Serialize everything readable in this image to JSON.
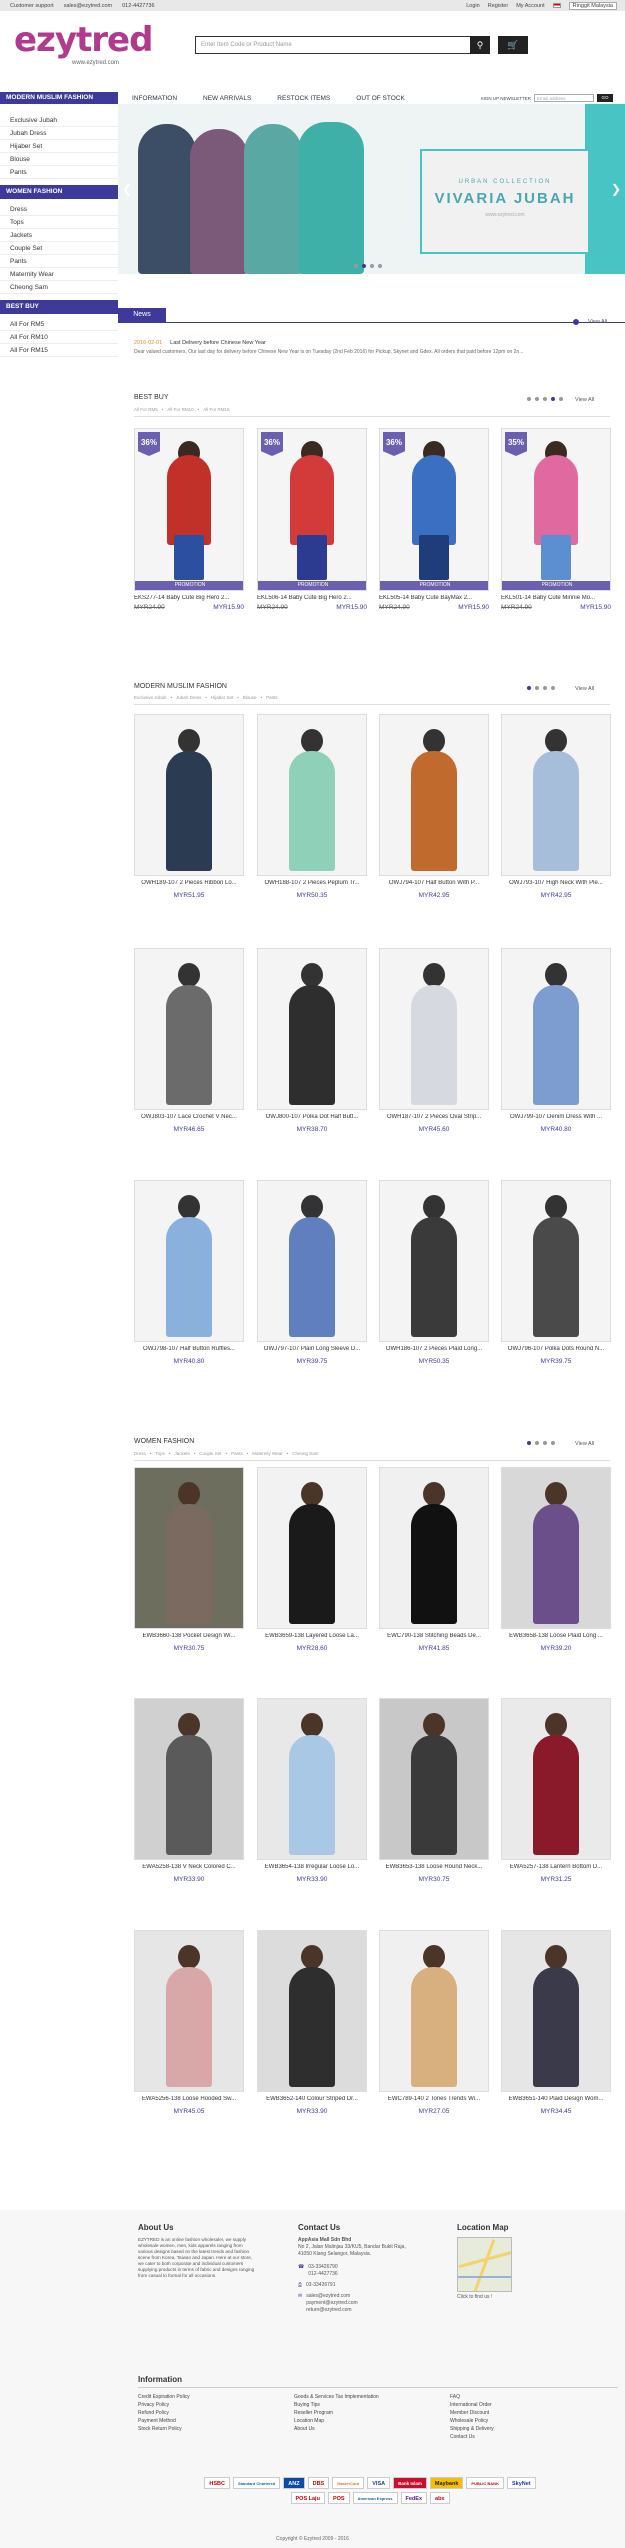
{
  "topbar": {
    "customer_support": "Customer support",
    "email": "sales@ezytred.com",
    "phone": "012-4427736",
    "login": "Login",
    "register": "Register",
    "my_account": "My Account",
    "currency": "Ringgit Malaysia"
  },
  "logo": {
    "text_a": "ezy",
    "text_b": "tred",
    "url": "www.ezytred.com"
  },
  "search": {
    "placeholder": "Enter Item Code or Product Name",
    "icon": "search-icon",
    "cart_icon": "cart-icon"
  },
  "nav": {
    "category_header": "MODERN MUSLIM FASHION",
    "menu": [
      "INFORMATION",
      "NEW ARRIVALS",
      "RESTOCK ITEMS",
      "OUT OF STOCK"
    ],
    "newsletter_label": "SIGN UP NEWSLETTER",
    "newsletter_placeholder": "Email address",
    "newsletter_button": "GO"
  },
  "sidebar": {
    "muslim": [
      "Exclusive Jubah",
      "Jubah Dress",
      "Hijaber Set",
      "Blouse",
      "Pants"
    ],
    "women_header": "WOMEN FASHION",
    "women": [
      "Dress",
      "Tops",
      "Jackets",
      "Couple Set",
      "Pants",
      "Maternity Wear",
      "Cheong Sam"
    ],
    "bestbuy_header": "BEST BUY",
    "bestbuy": [
      "All For RM5",
      "All For RM10",
      "All For RM15"
    ]
  },
  "hero": {
    "line1": "URBAN COLLECTION",
    "line2": "VIVARIA JUBAH",
    "line3": "www.ezytred.com",
    "accent": "#48c4c4"
  },
  "news": {
    "tab": "News",
    "view_all": "View All",
    "date": "2016-02-01",
    "headline": "Last Delivery before Chinese New Year",
    "desc": "Dear valued customers,   Our last day for delivery before Chinese New Year is on Tuesday (2nd Feb 2016) for Pickup, Skynet and Gdex. All orders that paid before 12pm on 2n..."
  },
  "best_buy": {
    "title": "BEST BUY",
    "tabs": [
      "All For RM5",
      "All For RM10",
      "All For RM15"
    ],
    "view_all": "View All",
    "items": [
      {
        "name": "EKS277-14 Baby Cute Big Hero 2...",
        "old": "MYR24.90",
        "new": "MYR15.90",
        "discount": "36%",
        "promo": "PROMOTION"
      },
      {
        "name": "EKL506-14 Baby Cute Big Hero 2...",
        "old": "MYR24.90",
        "new": "MYR15.90",
        "discount": "36%",
        "promo": "PROMOTION"
      },
      {
        "name": "EKL505-14 Baby Cute BayMax 2...",
        "old": "MYR24.90",
        "new": "MYR15.90",
        "discount": "36%",
        "promo": "PROMOTION"
      },
      {
        "name": "EKL501-14 Baby Cute Minnie Mo...",
        "old": "MYR24.90",
        "new": "MYR15.90",
        "discount": "35%",
        "promo": "PROMOTION"
      }
    ]
  },
  "muslim_section": {
    "title": "MODERN MUSLIM FASHION",
    "tabs": [
      "Exclusive Jubah",
      "Jubah Dress",
      "Hijaber Set",
      "Blouse",
      "Pants"
    ],
    "view_all": "View All",
    "items": [
      {
        "name": "OWH189-107 2 Pieces Ribbon Lo...",
        "price": "MYR51.95"
      },
      {
        "name": "OWH188-107 2 Pieces Peplum Tr...",
        "price": "MYR50.35"
      },
      {
        "name": "OWJ794-107 Half Button With P...",
        "price": "MYR42.95"
      },
      {
        "name": "OWJ793-107 High Neck With Ple...",
        "price": "MYR42.95"
      },
      {
        "name": "OWJ803-107 Lace Crochet V Nec...",
        "price": "MYR46.65"
      },
      {
        "name": "OWJ800-107 Polka Dot Half Butt...",
        "price": "MYR38.70"
      },
      {
        "name": "OWH187-107 2 Pieces Oval Strip...",
        "price": "MYR45.60"
      },
      {
        "name": "OWJ799-107 Denim Dress With ...",
        "price": "MYR40.80"
      },
      {
        "name": "OWJ798-107 Half Button Ruffles...",
        "price": "MYR40.80"
      },
      {
        "name": "OWJ797-107 Plain Long Sleeve D...",
        "price": "MYR39.75"
      },
      {
        "name": "OWH186-107 2 Pieces Plaid Long...",
        "price": "MYR50.35"
      },
      {
        "name": "OWJ796-107 Polka Dots Round N...",
        "price": "MYR39.75"
      }
    ]
  },
  "women_section": {
    "title": "WOMEN FASHION",
    "tabs": [
      "Dress",
      "Tops",
      "Jackets",
      "Couple Set",
      "Pants",
      "Maternity Wear",
      "Cheong Sam"
    ],
    "view_all": "View All",
    "items": [
      {
        "name": "EWB3660-138 Pocket Design Wi...",
        "price": "MYR30.75"
      },
      {
        "name": "EWB3659-138 Layered Loose La...",
        "price": "MYR28.60"
      },
      {
        "name": "EWC790-138 Stitching Beads De...",
        "price": "MYR41.85"
      },
      {
        "name": "EWB3658-138 Loose Plaid Long ...",
        "price": "MYR39.20"
      },
      {
        "name": "EWA5258-138 V Neck Colored C...",
        "price": "MYR33.90"
      },
      {
        "name": "EWB3654-138 Irregular Loose Lo...",
        "price": "MYR33.90"
      },
      {
        "name": "EWB3653-138 Loose Round Neck...",
        "price": "MYR30.75"
      },
      {
        "name": "EWA5257-138 Lantern Bottom D...",
        "price": "MYR31.25"
      },
      {
        "name": "EWA5256-138 Loose Hooded Sw...",
        "price": "MYR45.05"
      },
      {
        "name": "EWB3652-140 Colour Striped Dr...",
        "price": "MYR33.90"
      },
      {
        "name": "EWC789-140 2 Tones Trends Wi...",
        "price": "MYR27.05"
      },
      {
        "name": "EWB3651-140 Plaid Design Wom...",
        "price": "MYR34.45"
      }
    ]
  },
  "footer": {
    "about_title": "About Us",
    "about_text": "EZYTRED is an online fashion wholesaler, we supply wholesale women, men, kids apparels ranging from various designs based on the latest trends and fashion scene from Korea, Taiwan and Japan. Here at our store, we cater to both corporate and individual customers supplying products in terms of fabric and designs ranging from casual to formal for all occasions.",
    "contact_title": "Contact Us",
    "company": "AppAsia Mall Sdn Bhd",
    "address": "No 2, Jalan Malinjau 33/KU5, Bandar Bukit Raja, 41050 Klang Selangor, Malaysia.",
    "phone1": "03-33426790",
    "phone2": "012-4427736",
    "fax": "03-33426791",
    "emails": [
      "sales@ezytred.com",
      "payment@ezytred.com",
      "return@ezytred.com"
    ],
    "map_title": "Location Map",
    "map_link": "Click to find us !",
    "info_title": "Information",
    "col1": [
      "Credit Expiration Policy",
      "Privacy Policy",
      "Refund Policy",
      "Payment Method",
      "Stock Return Policy"
    ],
    "col2": [
      "Goods & Services Tax Implementation",
      "Buying Tips",
      "Reseller Program",
      "Location Map",
      "About Us"
    ],
    "col3": [
      "FAQ",
      "International Order",
      "Member Discount",
      "Wholesale Policy",
      "Shipping & Delivery",
      "Contact Us"
    ],
    "payments": [
      "HSBC",
      "Standard Chartered",
      "ANZ",
      "DBS",
      "MasterCard",
      "VISA",
      "Bank Islam",
      "Maybank",
      "PUBLIC BANK",
      "SkyNet",
      "POS Laju",
      "POS",
      "American Express",
      "FedEx",
      "abx"
    ],
    "copyright": "Copyright © Ezytred 2009 - 2016"
  }
}
